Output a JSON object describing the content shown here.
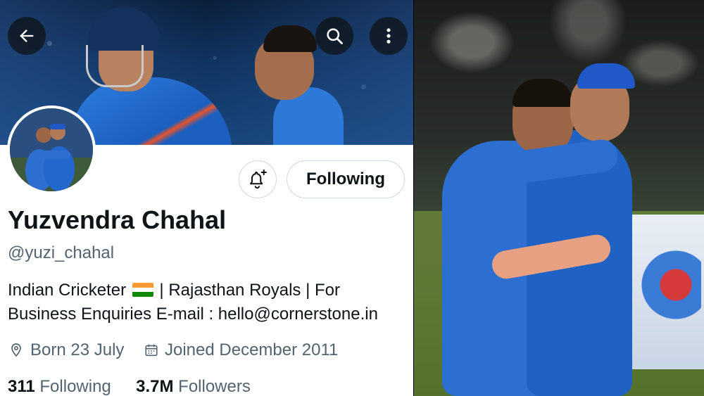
{
  "profile": {
    "name": "Yuzvendra Chahal",
    "handle": "@yuzi_chahal",
    "bio_line1_pre": "Indian Cricketer",
    "bio_line1_post": "| Rajasthan Royals | For",
    "bio_line2": "Business Enquiries E-mail : hello@cornerstone.in",
    "born": "Born 23 July",
    "joined": "Joined December 2011",
    "following_count": "311",
    "following_label": "Following",
    "followers_count": "3.7M",
    "followers_label": "Followers",
    "follow_button_label": "Following"
  },
  "icons": {
    "back": "arrow-left-icon",
    "search": "search-icon",
    "more": "more-vertical-icon",
    "notify": "bell-plus-icon",
    "location": "location-pin-icon",
    "calendar": "calendar-icon",
    "flag": "india-flag-emoji"
  },
  "colors": {
    "text_primary": "#0f1419",
    "text_secondary": "#536471",
    "border": "#cfd9de",
    "jersey_blue": "#2c6fd0",
    "flag_saffron": "#ff9933",
    "flag_green": "#138808"
  }
}
